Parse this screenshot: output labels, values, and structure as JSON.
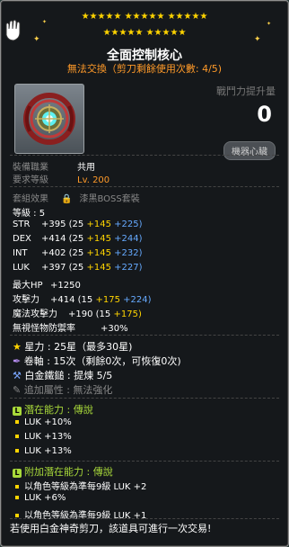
{
  "stars_row1": "★★★★★  ★★★★★  ★★★★★",
  "stars_row2": "★★★★★  ★★★★★",
  "title": "全面控制核心",
  "subtitle": "無法交換（剪刀剩餘使用次數: 4/5)",
  "power_label": "戰鬥力提升量",
  "power_value": "0",
  "heart_badge": "機器心臟",
  "equip_job_label": "裝備職業",
  "equip_job_value": "共用",
  "req_level_label": "要求等級",
  "req_level_value": "Lv. 200",
  "set_label": "套組效果",
  "set_value": "漆黑BOSS套裝",
  "grade": "等級 : 5",
  "stats": [
    {
      "name": "STR",
      "total": "+395",
      "base": "(25",
      "plus1": "+145",
      "plus2": "+225)"
    },
    {
      "name": "DEX",
      "total": "+414",
      "base": "(25",
      "plus1": "+145",
      "plus2": "+244)"
    },
    {
      "name": "INT",
      "total": "+402",
      "base": "(25",
      "plus1": "+145",
      "plus2": "+232)"
    },
    {
      "name": "LUK",
      "total": "+397",
      "base": "(25",
      "plus1": "+145",
      "plus2": "+227)"
    }
  ],
  "maxhp_label": "最大HP",
  "maxhp_value": "+1250",
  "atk_label": "攻擊力",
  "atk_total": "+414",
  "atk_base": "(15",
  "atk_p1": "+175",
  "atk_p2": "+224)",
  "matk_label": "魔法攻擊力",
  "matk_total": "+190",
  "matk_base": "(15",
  "matk_p1": "+175)",
  "ignore_label": "無視怪物防禦率",
  "ignore_value": "+30%",
  "star_force": "星力 : 25星（最多30星)",
  "scroll": "卷軸 : 15次（剩餘0次，可恢復0次)",
  "hammer": "白金鐵鎚 : 提煉 5/5",
  "extra_attr": "追加屬性 : 無法強化",
  "potential_label": "潛在能力 :",
  "potential_grade": "傳說",
  "potential_lines": [
    "LUK +10%",
    "LUK +13%",
    "LUK +13%"
  ],
  "add_potential_label": "附加潛在能力 :",
  "add_potential_grade": "傳說",
  "add_potential_lines": [
    "以角色等級為準每9級 LUK +2",
    "LUK +6%",
    "以角色等級為準每9級 LUK +1"
  ],
  "bottom_note": "若使用白金神奇剪刀，該道具可進行一次交易!",
  "colors": {
    "yellow": "#ffd400",
    "blue": "#66aaff",
    "orange": "#ff9a29",
    "green": "#a8d93a"
  }
}
